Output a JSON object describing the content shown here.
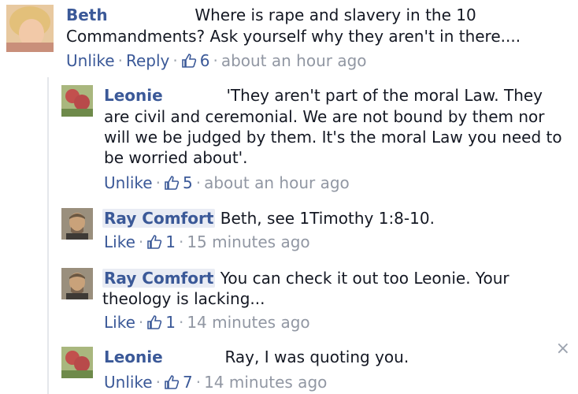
{
  "comments": [
    {
      "author": "Beth",
      "text": "Where is rape and slavery in the 10 Commandments? Ask yourself why they aren't in there....",
      "text_line1": "Where is rape and slavery in the 10",
      "text_line2": "Commandments? Ask yourself why they aren't in there....",
      "actions": [
        "Unlike",
        "Reply"
      ],
      "likes": "6",
      "time": "about an hour ago"
    },
    {
      "author": "Leonie",
      "text": "'They aren't part of the moral Law. They are civil and ceremonial. We are not bound by them nor will we be judged by them. It's the moral Law you need to be worried about'.",
      "text_line1": "'They aren't part of the moral Law. They",
      "text_line2": "are civil and ceremonial. We are not bound by them nor",
      "text_line3": "will we be judged by them. It's the moral Law you need to",
      "text_line4": "be worried about'.",
      "actions": [
        "Unlike"
      ],
      "likes": "5",
      "time": "about an hour ago"
    },
    {
      "author": "Ray Comfort",
      "text": "Beth, see 1Timothy 1:8-10.",
      "actions": [
        "Like"
      ],
      "likes": "1",
      "time": "15 minutes ago"
    },
    {
      "author": "Ray Comfort",
      "text": "You can check it out too Leonie. Your theology is lacking...",
      "text_line1": "You can check it out too Leonie. Your",
      "text_line2": "theology is lacking...",
      "actions": [
        "Like"
      ],
      "likes": "1",
      "time": "14 minutes ago"
    },
    {
      "author": "Leonie",
      "text": "Ray, I was quoting you.",
      "actions": [
        "Unlike"
      ],
      "likes": "7",
      "time": "14 minutes ago"
    }
  ],
  "close_icon": "×",
  "colors": {
    "link": "#3b5998",
    "meta": "#9197a3",
    "tag_bg": "#e9ecf4"
  }
}
